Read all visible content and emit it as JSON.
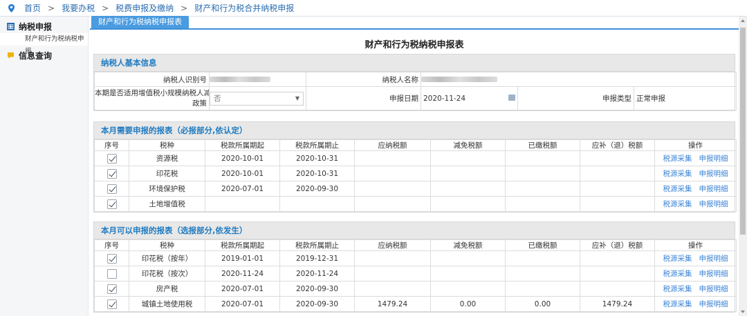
{
  "breadcrumb": [
    "首页",
    "我要办税",
    "税费申报及缴纳",
    "财产和行为税合并纳税申报"
  ],
  "sidebar": {
    "groups": [
      {
        "label": "纳税申报",
        "icon": "table-icon",
        "items": [
          "财产和行为税纳税申报"
        ]
      },
      {
        "label": "信息查询",
        "icon": "chat-icon",
        "items": []
      }
    ]
  },
  "tab": "财产和行为税纳税申报表",
  "page_title": "财产和行为税纳税申报表",
  "basic_info": {
    "header": "纳税人基本信息",
    "taxpayer_id_label": "纳税人识别号",
    "taxpayer_name_label": "纳税人名称",
    "small_scale_label_1": "本期是否适用增值税小规模纳税人减征",
    "small_scale_label_2": "政策",
    "small_scale_value": "否",
    "date_label": "申报日期",
    "date_value": "2020-11-24",
    "type_label": "申报类型",
    "type_value": "正常申报"
  },
  "columns": [
    "序号",
    "税种",
    "税款所属期起",
    "税款所属期止",
    "应纳税额",
    "减免税额",
    "已缴税额",
    "应补（退）税额",
    "操作"
  ],
  "actions": {
    "collect": "税源采集",
    "detail": "申报明细"
  },
  "required": {
    "header": "本月需要申报的报表（必报部分,依认定）",
    "rows": [
      {
        "checked": true,
        "tax": "资源税",
        "start": "2020-10-01",
        "end": "2020-10-31",
        "payable": "",
        "relief": "",
        "paid": "",
        "due": ""
      },
      {
        "checked": true,
        "tax": "印花税",
        "start": "2020-10-01",
        "end": "2020-10-31",
        "payable": "",
        "relief": "",
        "paid": "",
        "due": ""
      },
      {
        "checked": true,
        "tax": "环境保护税",
        "start": "2020-07-01",
        "end": "2020-09-30",
        "payable": "",
        "relief": "",
        "paid": "",
        "due": ""
      },
      {
        "checked": true,
        "tax": "土地增值税",
        "start": "",
        "end": "",
        "payable": "",
        "relief": "",
        "paid": "",
        "due": ""
      }
    ]
  },
  "optional": {
    "header": "本月可以申报的报表（选报部分,依发生）",
    "rows": [
      {
        "checked": true,
        "tax": "印花税（按年）",
        "start": "2019-01-01",
        "end": "2019-12-31",
        "payable": "",
        "relief": "",
        "paid": "",
        "due": ""
      },
      {
        "checked": false,
        "tax": "印花税（按次）",
        "start": "2020-11-24",
        "end": "2020-11-24",
        "payable": "",
        "relief": "",
        "paid": "",
        "due": ""
      },
      {
        "checked": true,
        "tax": "房产税",
        "start": "2020-07-01",
        "end": "2020-09-30",
        "payable": "",
        "relief": "",
        "paid": "",
        "due": ""
      },
      {
        "checked": true,
        "tax": "城镇土地使用税",
        "start": "2020-07-01",
        "end": "2020-09-30",
        "payable": "1479.24",
        "relief": "0.00",
        "paid": "0.00",
        "due": "1479.24"
      }
    ]
  },
  "colors": {
    "accent": "#3d8fd8",
    "link": "#3b84d6",
    "section_head": "#1f7bc2"
  }
}
